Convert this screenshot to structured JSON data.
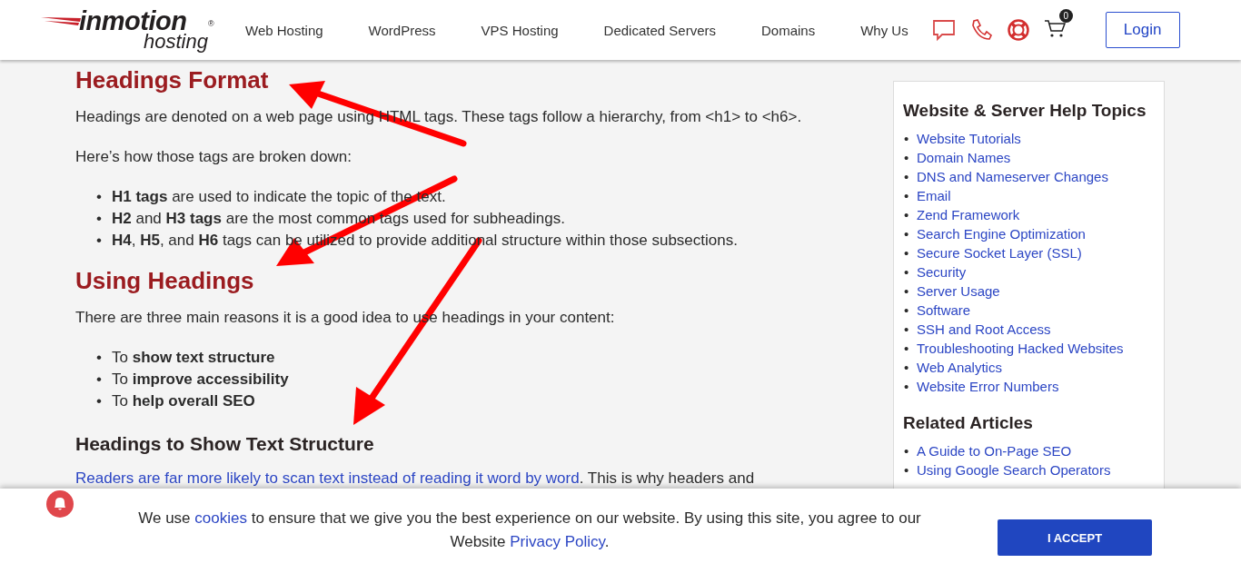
{
  "header": {
    "logo": {
      "line1": "inmotion",
      "line2": "hosting",
      "mark": "®"
    },
    "nav": [
      {
        "label": "Web Hosting"
      },
      {
        "label": "WordPress"
      },
      {
        "label": "VPS Hosting"
      },
      {
        "label": "Dedicated Servers"
      },
      {
        "label": "Domains"
      },
      {
        "label": "Why Us"
      }
    ],
    "cart_count": "0",
    "login": "Login"
  },
  "article": {
    "sections": [
      {
        "kind": "h2",
        "text": "Headings Format"
      },
      {
        "kind": "p",
        "text": "Headings are denoted on a web page using HTML tags. These tags follow a hierarchy, from <h1> to <h6>."
      },
      {
        "kind": "p",
        "text": "Here’s how those tags are broken down:"
      },
      {
        "kind": "list",
        "bullet": "•",
        "items": [
          "**H1 tags** are used to indicate the topic of the text.",
          "**H2** and **H3 tags** are the most common tags used for subheadings.",
          "**H4**, **H5**, and **H6** tags can be utilized to provide additional structure within those subsections."
        ]
      },
      {
        "kind": "h2",
        "text": "Using Headings"
      },
      {
        "kind": "p",
        "text": "There are three main reasons it is a good idea to use headings in your content:"
      },
      {
        "kind": "list",
        "bullet": "•",
        "items": [
          "To **show text structure**",
          "To **improve accessibility**",
          "To **help overall SEO**"
        ]
      },
      {
        "kind": "h3",
        "text": "Headings to Show Text Structure"
      },
      {
        "kind": "linkp",
        "link": "Readers are far more likely to scan text instead of reading it word by word",
        "text": ". This is why headers and"
      }
    ]
  },
  "sidebar": {
    "sections": [
      {
        "title": "Website & Server Help Topics",
        "bullet": "•",
        "links": [
          "Website Tutorials",
          "Domain Names",
          "DNS and Nameserver Changes",
          "Email",
          "Zend Framework",
          "Search Engine Optimization",
          "Secure Socket Layer (SSL)",
          "Security",
          "Server Usage",
          "Software",
          "SSH and Root Access",
          "Troubleshooting Hacked Websites",
          "Web Analytics",
          "Website Error Numbers"
        ]
      },
      {
        "title": "Related Articles",
        "bullet": "•",
        "links": [
          "A Guide to On-Page SEO",
          "Using Google Search Operators"
        ]
      }
    ]
  },
  "cookie_banner": {
    "text_before": "We use ",
    "cookies_link": "cookies",
    "text_middle": " to ensure that we give you the best experience on our website. By using this site,  you agree to our Website ",
    "privacy_link": "Privacy Policy",
    "text_after": ".",
    "button": "I ACCEPT"
  }
}
